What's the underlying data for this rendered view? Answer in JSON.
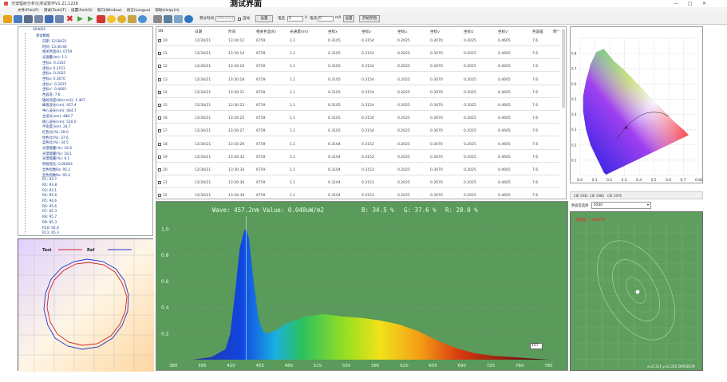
{
  "titlebar": {
    "title": "光谱辐射分析仪测试软件V1.21.1228",
    "overlay": "测试界面",
    "minimize": "—",
    "maximize": "□",
    "close": "✕"
  },
  "menu": [
    "文件(File)(F)",
    "测试(Test)(T)",
    "设置(Set)(S)",
    "窗口(Window)",
    "语言(Langue)",
    "帮助(Help)(H)"
  ],
  "toolbar": {
    "integration_label": "积分时间",
    "integration_value": "200 (ms)",
    "auto_label": "自动",
    "set_button": "设置",
    "voltage_label": "电压",
    "voltage_value": "0",
    "voltage_unit": "V",
    "current_label": "电流",
    "current_value": "0",
    "current_unit": "mA",
    "set_button2": "设置",
    "filter_button": "开始存档"
  },
  "tree": {
    "root": "SP4002",
    "group": "测试数据",
    "items": [
      "日期: 12/30/21",
      "时间: 13:30:40",
      "相关色温(K): 6759",
      "光通量(lm): 1.1",
      "坐标x: 0.3104",
      "坐标y: 0.3153",
      "坐标u: 0.2025",
      "坐标v: 0.3070",
      "坐标u': 0.2025",
      "坐标v': 0.4605",
      "色容差: 7.6",
      "辐射亮度(W/sr·m2): 1.467",
      "峰值波长(nm): 457.4",
      "中心波长(nm): 464.7",
      "主波长(nm): 480.7",
      "质心波长(nm): 510.0",
      "半宽度(nm): 24.7",
      "红色比(%): 28.0",
      "绿色比(%): 37.6",
      "蓝色比(%): 34.5",
      "光谱能量(%): 16.4",
      "光谱能量(%): 18.1",
      "光谱能量(%): 9.1",
      "明视觉比: 0.00283",
      "显色指数Ra: 95.2",
      "显色指数Re: 95.4",
      "R1: 93.7",
      "R2: 93.8",
      "R3: 93.1",
      "R4: 95.6",
      "R5: 94.6",
      "R6: 95.6",
      "R7: 95.3",
      "R8: 95.7",
      "R9: 85.3",
      "R10: 92.0",
      "R11: 95.3"
    ]
  },
  "table": {
    "columns": [
      "SN",
      "日期",
      "时间",
      "相关色温(K)",
      "光通量(lm)",
      "坐标x",
      "坐标y",
      "坐标u",
      "坐标v",
      "坐标u'",
      "坐标v'",
      "色容差",
      "明^"
    ],
    "rows": [
      [
        "10",
        "12/30/21",
        "13:30:12",
        "6759",
        "1.1",
        "0.3105",
        "0.3154",
        "0.2025",
        "0.3070",
        "0.2025",
        "0.4605",
        "7.6"
      ],
      [
        "11",
        "12/30/21",
        "13:30:14",
        "6759",
        "1.1",
        "0.3105",
        "0.3154",
        "0.2025",
        "0.3070",
        "0.2025",
        "0.4605",
        "7.6"
      ],
      [
        "12",
        "12/30/21",
        "13:30:16",
        "6759",
        "1.1",
        "0.3105",
        "0.3154",
        "0.2025",
        "0.3070",
        "0.2025",
        "0.4605",
        "7.6"
      ],
      [
        "13",
        "12/30/21",
        "13:30:18",
        "6759",
        "1.1",
        "0.3105",
        "0.3154",
        "0.2025",
        "0.3070",
        "0.2025",
        "0.4605",
        "7.6"
      ],
      [
        "14",
        "12/30/21",
        "13:30:21",
        "6759",
        "1.1",
        "0.3105",
        "0.3154",
        "0.2025",
        "0.3070",
        "0.2025",
        "0.4605",
        "7.6"
      ],
      [
        "15",
        "12/30/21",
        "13:30:23",
        "6759",
        "1.1",
        "0.3105",
        "0.3154",
        "0.2025",
        "0.3070",
        "0.2025",
        "0.4605",
        "7.6"
      ],
      [
        "16",
        "12/30/21",
        "13:30:25",
        "6759",
        "1.1",
        "0.3105",
        "0.3154",
        "0.2025",
        "0.3070",
        "0.2025",
        "0.4605",
        "7.6"
      ],
      [
        "17",
        "12/30/21",
        "13:30:27",
        "6759",
        "1.1",
        "0.3105",
        "0.3154",
        "0.2025",
        "0.3070",
        "0.2025",
        "0.4605",
        "7.6"
      ],
      [
        "18",
        "12/30/21",
        "13:30:29",
        "6759",
        "1.1",
        "0.3104",
        "0.3152",
        "0.2025",
        "0.3070",
        "0.2025",
        "0.4605",
        "7.6"
      ],
      [
        "19",
        "12/30/21",
        "13:30:32",
        "6759",
        "1.1",
        "0.3104",
        "0.3152",
        "0.2025",
        "0.3070",
        "0.2025",
        "0.4605",
        "7.6"
      ],
      [
        "20",
        "12/30/21",
        "13:30:34",
        "6759",
        "1.1",
        "0.3104",
        "0.3153",
        "0.2025",
        "0.3070",
        "0.2025",
        "0.4605",
        "7.6"
      ],
      [
        "21",
        "12/30/21",
        "13:30:36",
        "6759",
        "1.1",
        "0.3104",
        "0.3153",
        "0.2025",
        "0.3070",
        "0.2025",
        "0.4605",
        "7.6"
      ],
      [
        "22",
        "12/30/21",
        "13:30:38",
        "6759",
        "1.1",
        "0.3104",
        "0.3153",
        "0.2025",
        "0.3070",
        "0.2025",
        "0.4605",
        "7.6"
      ],
      [
        "23",
        "12/30/21",
        "13:30:40",
        "6759",
        "1.1",
        "0.3104",
        "0.3153",
        "0.2025",
        "0.3070",
        "0.2025",
        "0.4605",
        "7.6"
      ]
    ]
  },
  "spectrum": {
    "wave_text": "Wave: 457.2nm Value: 0.048uW/m2",
    "blue_text": "B: 34.5 %",
    "green_text": "G: 37.6 %",
    "red_text": "R: 28.0 %",
    "dropdown": "1ST",
    "y_ticks": [
      "1.0",
      "0.8",
      "0.6",
      "0.4",
      "0.2"
    ],
    "x_ticks": [
      "380",
      "395",
      "420",
      "455",
      "480",
      "515",
      "550",
      "585",
      "620",
      "655",
      "690",
      "725",
      "760",
      "780"
    ]
  },
  "polar": {
    "test_label": "Test",
    "ref_label": "Ref"
  },
  "cie": {
    "x_ticks": [
      "0.0",
      "0.1",
      "0.2",
      "0.3",
      "0.4",
      "0.5",
      "0.6",
      "0.7",
      "0.8x"
    ],
    "y_ticks": [
      "0.8",
      "0.7",
      "0.6",
      "0.5",
      "0.4",
      "0.3",
      "0.2",
      "0.1"
    ],
    "tabs": [
      "CIE 1931",
      "CIE 1960",
      "CIE 1976"
    ]
  },
  "tolerance": {
    "label": "色容差选择",
    "select_value": "6500",
    "top_text": "色容差: 7.6SDCM",
    "bottom_text": "x=0.311 y=0.320 D65SDCM"
  },
  "colors": {
    "spectrum_bg": "#5a9a5a",
    "tolerance_bg": "#5e9e5e",
    "test_curve": "#cc2222",
    "ref_curve": "#2233cc"
  },
  "chart_data": [
    {
      "type": "line",
      "title": "",
      "xlabel": "",
      "ylabel": "",
      "xlim": [
        380,
        780
      ],
      "ylim": [
        0,
        1.1
      ],
      "series": [
        {
          "x": [
            380,
            400,
            420,
            435,
            440,
            445,
            450,
            455,
            457,
            460,
            465,
            470,
            475,
            480,
            490,
            500,
            520,
            540,
            560,
            580,
            600,
            620,
            640,
            660,
            680,
            700,
            720,
            740,
            760,
            780
          ],
          "values": [
            0.0,
            0.0,
            0.02,
            0.08,
            0.2,
            0.5,
            0.85,
            0.99,
            1.0,
            0.93,
            0.6,
            0.32,
            0.22,
            0.2,
            0.23,
            0.28,
            0.33,
            0.35,
            0.33,
            0.32,
            0.3,
            0.27,
            0.22,
            0.15,
            0.09,
            0.05,
            0.03,
            0.02,
            0.01,
            0.0
          ]
        }
      ]
    },
    {
      "type": "scatter",
      "title": "",
      "xlabel": "",
      "ylabel": "",
      "xlim": [
        0,
        0.8
      ],
      "ylim": [
        0,
        0.9
      ],
      "series": [
        {
          "x": [
            0.31
          ],
          "values": [
            0.315
          ]
        }
      ]
    }
  ]
}
